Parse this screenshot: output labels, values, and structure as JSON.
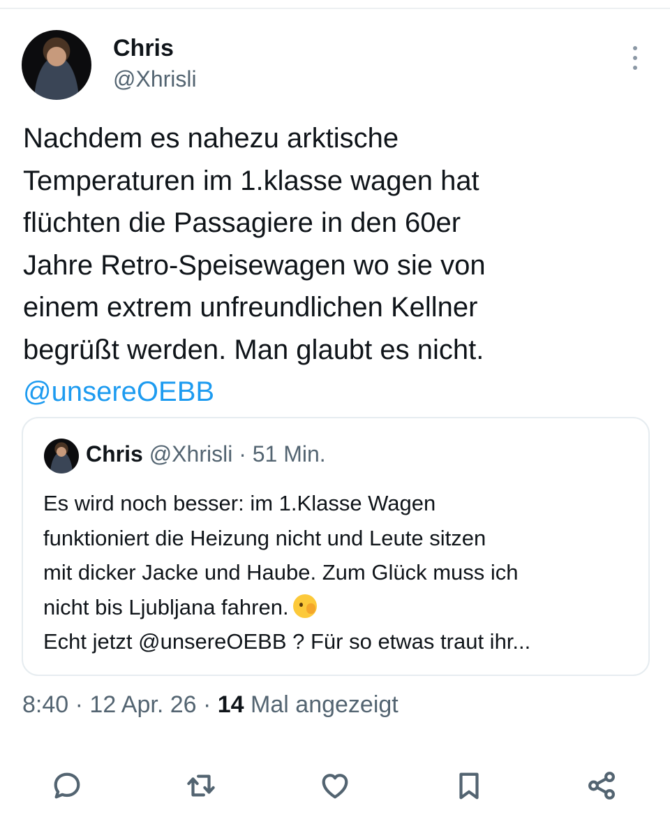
{
  "author": {
    "name": "Chris",
    "handle": "@Xhrisli"
  },
  "tweet": {
    "lines": [
      "Nachdem es nahezu arktische",
      "Temperaturen im 1.klasse wagen hat",
      "flüchten die Passagiere in den 60er",
      "Jahre Retro-Speisewagen wo sie von",
      "einem extrem unfreundlichen Kellner",
      "begrüßt werden. Man glaubt es nicht."
    ],
    "mention": "@unsereOEBB"
  },
  "quote": {
    "name": "Chris",
    "handle": "@Xhrisli",
    "time": " · 51 Min.",
    "lines": [
      "Es wird noch besser: im 1.Klasse Wagen",
      "funktioniert die Heizung nicht und Leute sitzen",
      "mit dicker Jacke und Haube. Zum Glück muss ich",
      "nicht bis Ljubljana fahren.",
      "Echt jetzt @unsereOEBB ? Für so etwas traut ihr..."
    ],
    "emoji": "face-with-peeking-eye-icon"
  },
  "meta": {
    "time": "8:40",
    "separator": " · ",
    "date": "12 Apr. 26",
    "views_count": "14",
    "views_label": "Mal angezeigt"
  },
  "actions": [
    {
      "name": "reply-icon"
    },
    {
      "name": "retweet-icon"
    },
    {
      "name": "like-icon"
    },
    {
      "name": "bookmark-icon"
    },
    {
      "name": "share-icon"
    }
  ],
  "colors": {
    "text": "#0f1419",
    "secondary": "#536471",
    "link": "#1d9bf0",
    "border": "#e6ecf0"
  }
}
